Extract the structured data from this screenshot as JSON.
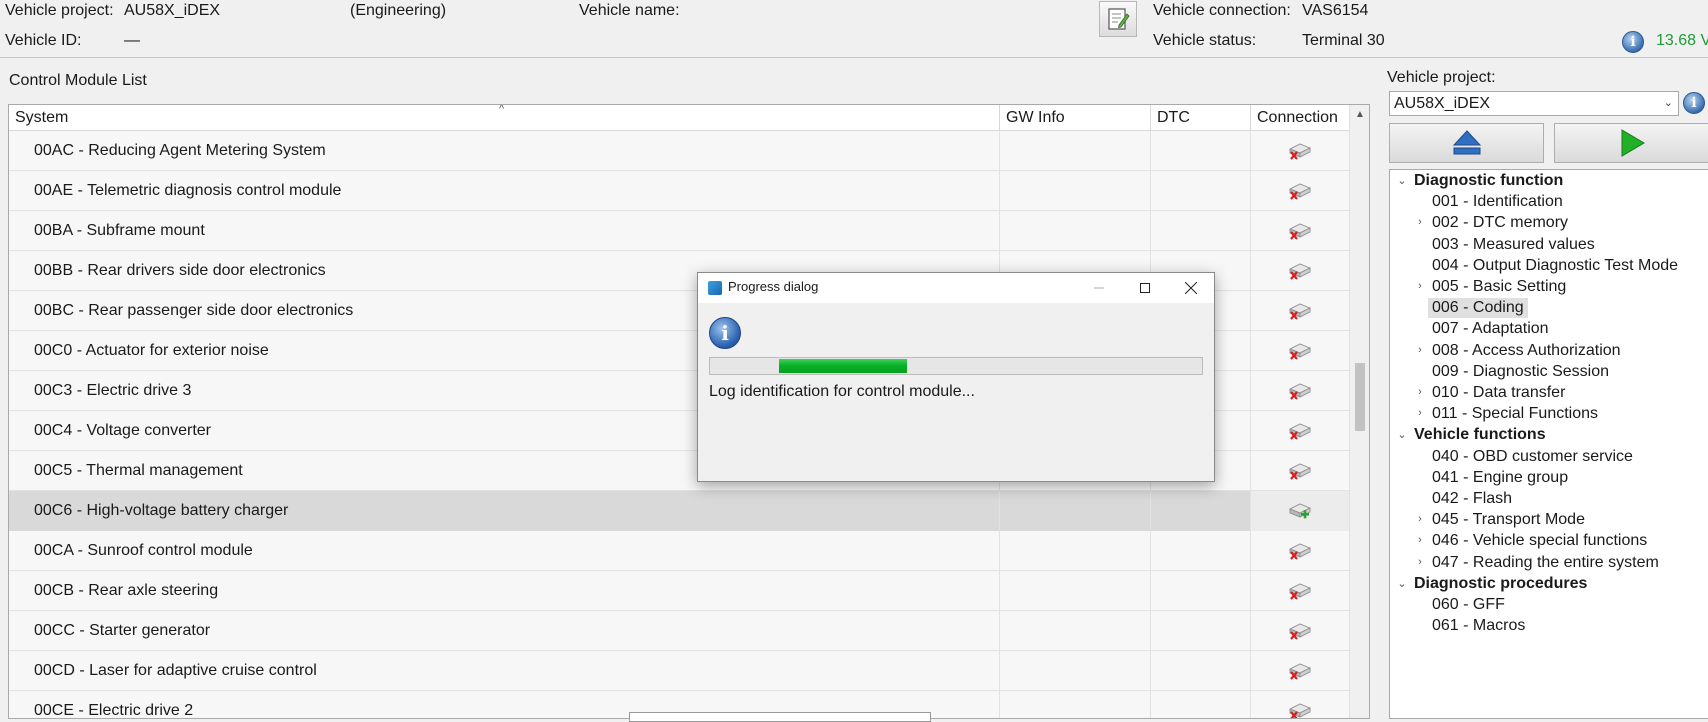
{
  "header": {
    "vehicle_project_label": "Vehicle project:",
    "vehicle_project_value": "AU58X_iDEX",
    "mode": "(Engineering)",
    "vehicle_name_label": "Vehicle name:",
    "vehicle_id_label": "Vehicle ID:",
    "vehicle_id_value": "—",
    "vehicle_connection_label": "Vehicle connection:",
    "vehicle_connection_value": "VAS6154",
    "vehicle_status_label": "Vehicle status:",
    "vehicle_status_value": "Terminal 30",
    "voltage": "13.68 V"
  },
  "module_list": {
    "title": "Control Module List",
    "columns": [
      "System",
      "GW Info",
      "DTC",
      "Connection"
    ],
    "rows": [
      {
        "system": "00AC - Reducing Agent Metering System",
        "status": "disconnected"
      },
      {
        "system": "00AE - Telemetric diagnosis control module",
        "status": "disconnected"
      },
      {
        "system": "00BA - Subframe mount",
        "status": "disconnected"
      },
      {
        "system": "00BB - Rear drivers side door electronics",
        "status": "disconnected"
      },
      {
        "system": "00BC - Rear passenger side door electronics",
        "status": "disconnected"
      },
      {
        "system": "00C0 - Actuator for exterior noise",
        "status": "disconnected"
      },
      {
        "system": "00C3 - Electric drive 3",
        "status": "disconnected"
      },
      {
        "system": "00C4 - Voltage converter",
        "status": "disconnected"
      },
      {
        "system": "00C5 - Thermal management",
        "status": "disconnected"
      },
      {
        "system": "00C6 - High-voltage battery charger",
        "status": "connected",
        "selected": true
      },
      {
        "system": "00CA - Sunroof control module",
        "status": "disconnected"
      },
      {
        "system": "00CB - Rear axle steering",
        "status": "disconnected"
      },
      {
        "system": "00CC - Starter generator",
        "status": "disconnected"
      },
      {
        "system": "00CD - Laser for adaptive cruise control",
        "status": "disconnected"
      },
      {
        "system": "00CE - Electric drive 2",
        "status": "disconnected"
      }
    ]
  },
  "right_panel": {
    "vehicle_project_label": "Vehicle project:",
    "vehicle_project_selected": "AU58X_iDEX",
    "tree": [
      {
        "label": "Diagnostic function",
        "level": 0,
        "bold": true,
        "expanded": true
      },
      {
        "label": "001 - Identification",
        "level": 1
      },
      {
        "label": "002 - DTC memory",
        "level": 1,
        "collapsible": true
      },
      {
        "label": "003 - Measured values",
        "level": 1
      },
      {
        "label": "004 - Output Diagnostic Test Mode",
        "level": 1
      },
      {
        "label": "005 - Basic Setting",
        "level": 1,
        "collapsible": true
      },
      {
        "label": "006 - Coding",
        "level": 1,
        "selected": true
      },
      {
        "label": "007 - Adaptation",
        "level": 1
      },
      {
        "label": "008 - Access Authorization",
        "level": 1,
        "collapsible": true
      },
      {
        "label": "009 - Diagnostic Session",
        "level": 1
      },
      {
        "label": "010 - Data transfer",
        "level": 1,
        "collapsible": true
      },
      {
        "label": "011 - Special Functions",
        "level": 1,
        "collapsible": true
      },
      {
        "label": "Vehicle functions",
        "level": 0,
        "bold": true,
        "expanded": true
      },
      {
        "label": "040 - OBD customer service",
        "level": 1
      },
      {
        "label": "041 - Engine group",
        "level": 1
      },
      {
        "label": "042 - Flash",
        "level": 1
      },
      {
        "label": "045 - Transport Mode",
        "level": 1,
        "collapsible": true
      },
      {
        "label": "046 - Vehicle special functions",
        "level": 1,
        "collapsible": true
      },
      {
        "label": "047 - Reading the entire system",
        "level": 1,
        "collapsible": true
      },
      {
        "label": "Diagnostic procedures",
        "level": 0,
        "bold": true,
        "expanded": true
      },
      {
        "label": "060 - GFF",
        "level": 1
      },
      {
        "label": "061 - Macros",
        "level": 1
      }
    ]
  },
  "progress_dialog": {
    "title": "Progress dialog",
    "message": "Log identification for control module...",
    "progress_start": 0.14,
    "progress_end": 0.4
  },
  "colors": {
    "progress_green": "#06b025",
    "voltage_green": "#1e9a3a",
    "play_green": "#22b028",
    "eject_blue": "#2e6fc4"
  }
}
